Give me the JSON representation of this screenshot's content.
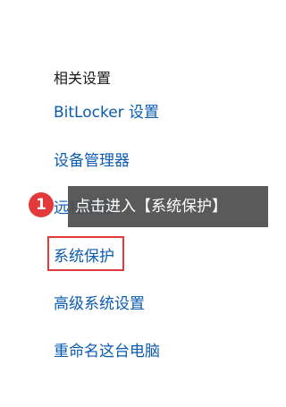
{
  "related_settings": {
    "heading": "相关设置",
    "links": [
      {
        "label": "BitLocker 设置"
      },
      {
        "label": "设备管理器"
      },
      {
        "label": "远程桌面"
      },
      {
        "label": "系统保护"
      },
      {
        "label": "高级系统设置"
      },
      {
        "label": "重命名这台电脑"
      }
    ]
  },
  "annotation": {
    "step_number": "1",
    "tooltip_text": "点击进入【系统保护】",
    "highlight_color": "#e23a3a"
  },
  "colors": {
    "link": "#0b5bb0",
    "heading": "#1a1a1a",
    "tooltip_bg": "#4c4c4c"
  }
}
